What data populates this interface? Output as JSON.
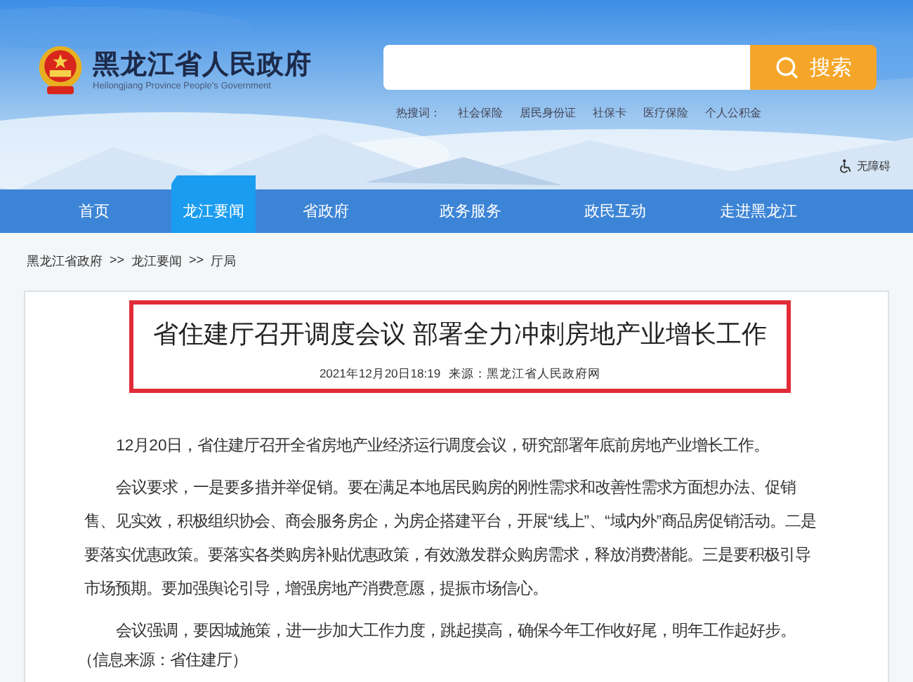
{
  "site": {
    "title": "黑龙江省人民政府",
    "subtitle": "Heilongjiang Province People's Government"
  },
  "search": {
    "button": "搜索"
  },
  "hot_words": {
    "label": "热搜词：",
    "items": [
      "社会保险",
      "居民身份证",
      "社保卡",
      "医疗保险",
      "个人公积金"
    ]
  },
  "accessibility": "无障碍",
  "nav": [
    {
      "label": "首页",
      "selected": false
    },
    {
      "label": "龙江要闻",
      "selected": true
    },
    {
      "label": "省政府",
      "selected": false
    },
    {
      "label": "政务服务",
      "selected": false
    },
    {
      "label": "政民互动",
      "selected": false
    },
    {
      "label": "走进黑龙江",
      "selected": false
    }
  ],
  "breadcrumb": {
    "items": [
      "黑龙江省政府",
      "龙江要闻",
      "厅局"
    ],
    "separators": [
      ">>",
      ">>"
    ]
  },
  "article": {
    "title": "省住建厅召开调度会议 部署全力冲刺房地产业增长工作",
    "date": "2021年12月20日18:19",
    "source": "来源：黑龙江省人民政府网",
    "paragraphs": [
      "12月20日，省住建厅召开全省房地产业经济运行调度会议，研究部署年底前房地产业增长工作。",
      "会议要求，一是要多措并举促销。要在满足本地居民购房的刚性需求和改善性需求方面想办法、促销售、见实效，积极组织协会、商会服务房企，为房企搭建平台，开展“线上”、“域内外”商品房促销活动。二是要落实优惠政策。要落实各类购房补贴优惠政策，有效激发群众购房需求，释放消费潜能。三是要积极引导市场预期。要加强舆论引导，增强房地产消费意愿，提振市场信心。",
      "会议强调，要因城施策，进一步加大工作力度，跳起摸高，确保今年工作收好尾，明年工作起好步。"
    ],
    "note": "（信息来源：省住建厅）"
  }
}
